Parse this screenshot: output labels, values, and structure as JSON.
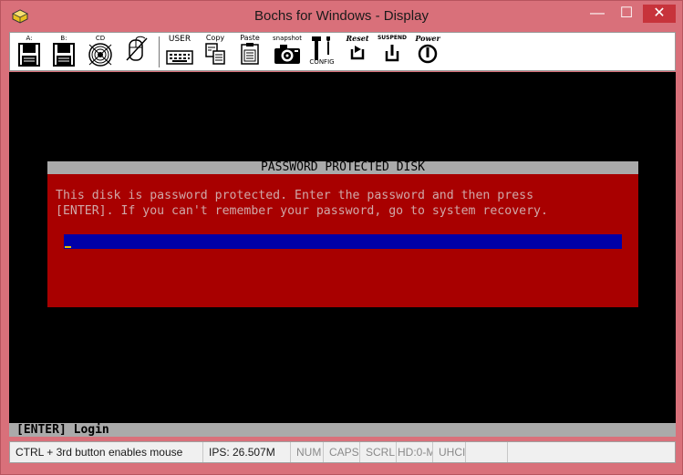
{
  "window": {
    "title": "Bochs for Windows - Display",
    "controls": {
      "minimize": "—",
      "maximize": "☐",
      "close": "✕"
    }
  },
  "toolbar": {
    "floppy_a_label": "A:",
    "floppy_b_label": "B:",
    "cdrom_label": "CD",
    "mouse_label": "",
    "user_label": "USER",
    "copy_label": "Copy",
    "paste_label": "Paste",
    "snapshot_label": "snapshot",
    "config_label": "CONFIG",
    "reset_label": "Reset",
    "suspend_label": "SUSPEND",
    "power_label": "Power"
  },
  "screen": {
    "dialog_title": "PASSWORD PROTECTED DISK",
    "message_line1": "This disk is password protected. Enter the password and then press",
    "message_line2": "[ENTER]. If you can't remember your password, go to system recovery.",
    "password_value": "",
    "bottom_hint": "[ENTER] Login"
  },
  "statusbar": {
    "mouse_hint": "CTRL + 3rd button enables mouse",
    "ips": "IPS: 26.507M",
    "num": "NUM",
    "caps": "CAPS",
    "scrl": "SCRL",
    "hd": "HD:0-M",
    "uhci": "UHCI"
  },
  "colors": {
    "titlebar": "#d9707a",
    "dialog_bg": "#a80000",
    "dialog_title_bg": "#aaaaaa",
    "input_bg": "#0000a8",
    "screen_bg": "#000000"
  }
}
